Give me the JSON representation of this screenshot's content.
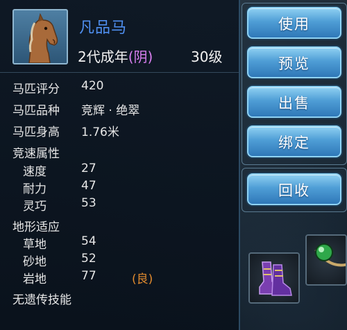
{
  "horse": {
    "name": "凡品马",
    "gen_age": "2代成年",
    "gender": "(阴)",
    "level": "30级"
  },
  "attributes": [
    {
      "label": "马匹评分",
      "value": "420"
    },
    {
      "label": "马匹品种",
      "value": "竞辉 · 绝翠"
    },
    {
      "label": "马匹身高",
      "value": "1.76米"
    }
  ],
  "speed_section": {
    "title": "竞速属性",
    "items": [
      {
        "label": "速度",
        "value": "27"
      },
      {
        "label": "耐力",
        "value": "47"
      },
      {
        "label": "灵巧",
        "value": "53"
      }
    ]
  },
  "terrain_section": {
    "title": "地形适应",
    "items": [
      {
        "label": "草地",
        "value": "54",
        "grade": ""
      },
      {
        "label": "砂地",
        "value": "52",
        "grade": ""
      },
      {
        "label": "岩地",
        "value": "77",
        "grade": "(良)"
      }
    ]
  },
  "footer_text": "无遗传技能",
  "buttons": {
    "use": "使用",
    "preview": "预览",
    "sell": "出售",
    "bind": "绑定",
    "recycle": "回收"
  },
  "colors": {
    "name": "#4f8ff0",
    "gender": "#d97ff0",
    "grade": "#e08a2e",
    "button": "#4f9ed6"
  },
  "icons": {
    "portrait": "horse-portrait-icon",
    "boots": "purple-boots-icon",
    "orb": "green-orb-amulet-icon"
  }
}
